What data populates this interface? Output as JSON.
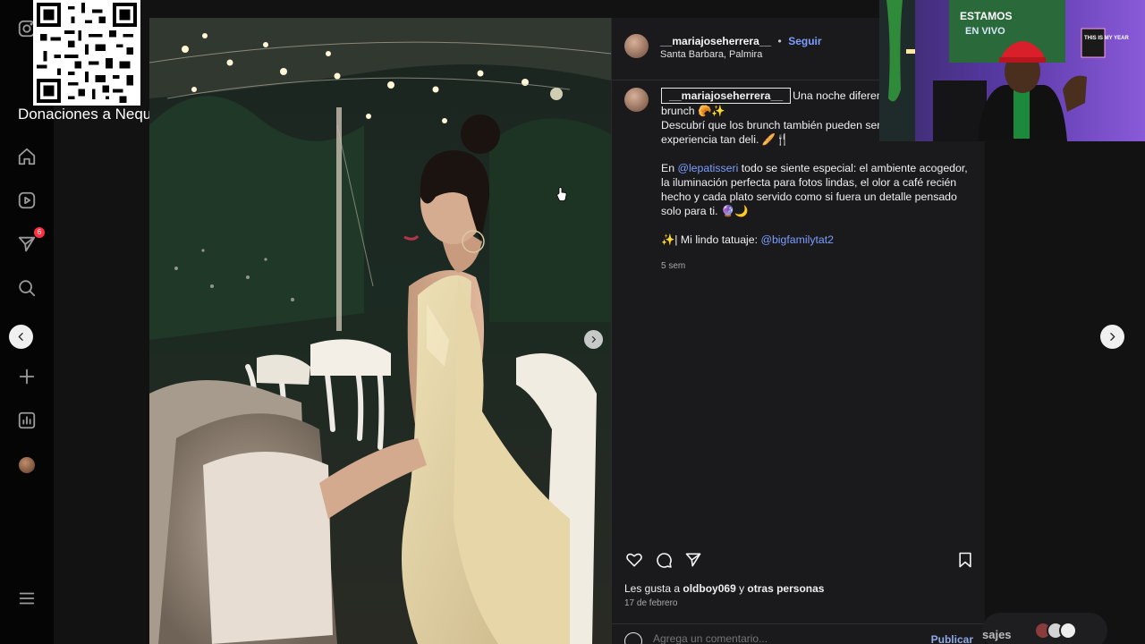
{
  "qr_overlay": {
    "label": "Donaciones a Nequi"
  },
  "sidebar": {
    "notifications_badge": "6",
    "items": [
      {
        "name": "instagram-logo-icon"
      },
      {
        "name": "home-icon"
      },
      {
        "name": "reels-icon"
      },
      {
        "name": "send-icon"
      },
      {
        "name": "search-icon"
      },
      {
        "name": "add-icon"
      },
      {
        "name": "insights-icon"
      },
      {
        "name": "profile-avatar"
      },
      {
        "name": "menu-icon"
      }
    ]
  },
  "post": {
    "username": "__mariajoseherrera__",
    "follow_label": "Seguir",
    "separator": "•",
    "location": "Santa Barbara, Palmira",
    "caption": {
      "username": "__mariajoseherrera__",
      "line1": "Una noche diferente, perc",
      "line2": "brunch 🥐✨",
      "line3": "Descubrí que los brunch también pueden ser nc",
      "line4": "experiencia tan deli. 🥖🍴",
      "para2_prefix": "En ",
      "para2_mention": "@lepatisseri",
      "para2_text": " todo se siente especial: el ambiente acogedor, la iluminación perfecta para fotos lindas, el olor a café recién hecho y cada plato servido como si fuera un detalle pensado solo para ti. 🔮🌙",
      "para3_prefix": "✨| Mi lindo tatuaje: ",
      "para3_mention": "@bigfamilytat2",
      "time_ago": "5 sem"
    },
    "likes_prefix": "Les gusta a ",
    "likes_user": "oldboy069",
    "likes_mid": " y ",
    "likes_others": "otras personas",
    "date": "17 de febrero",
    "comment_placeholder": "Agrega un comentario...",
    "publish_label": "Publicar"
  },
  "messages": {
    "label": "sajes"
  },
  "webcam": {
    "sign_title": "ESTAMOS",
    "sign_subtitle": "EN VIVO",
    "poster_text": "THIS IS MY YEAR"
  },
  "colors": {
    "accent_link": "#7c9eff",
    "panel_bg": "#1a1a1c",
    "badge": "#ff3040"
  }
}
